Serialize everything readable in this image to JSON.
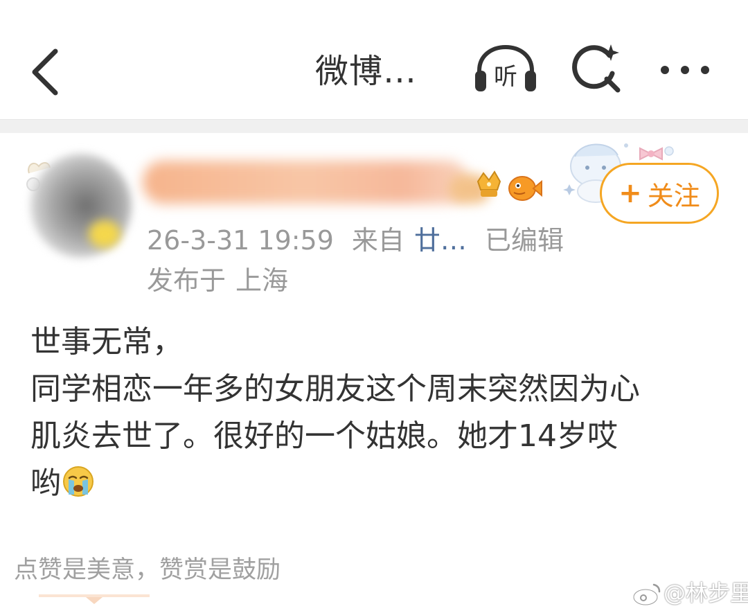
{
  "header": {
    "back_icon": "chevron-left-icon",
    "title": "微博…",
    "listen_label": "听",
    "listen_icon": "headphones-icon",
    "search_icon": "search-sparkle-icon",
    "more_icon": "more-dots-icon"
  },
  "author": {
    "avatar": "blurred-avatar",
    "username": "",
    "badges": [
      "crown-badge-icon",
      "fish-badge-icon"
    ],
    "follow_label": "关注",
    "follow_plus": "+"
  },
  "meta": {
    "date": "26-3-31 19:59",
    "from_label": "来自",
    "source": "廿…",
    "edited": "已编辑",
    "location_label": "发布于",
    "location": "上海"
  },
  "post": {
    "lines": [
      "世事无常，",
      "同学相恋一年多的女朋友这个周末突然因为心",
      "肌炎去世了。很好的一个姑娘。她才14岁哎",
      "哟"
    ],
    "emoji": "crying-face-icon"
  },
  "footer": {
    "reward_text": "点赞是美意，赞赏是鼓励",
    "watermark": "@林步里"
  },
  "colors": {
    "accent_orange": "#f5a623",
    "follow_text": "#f08c1a",
    "meta_gray": "#999999",
    "source_blue": "#4f6f9c",
    "body_text": "#333333"
  }
}
